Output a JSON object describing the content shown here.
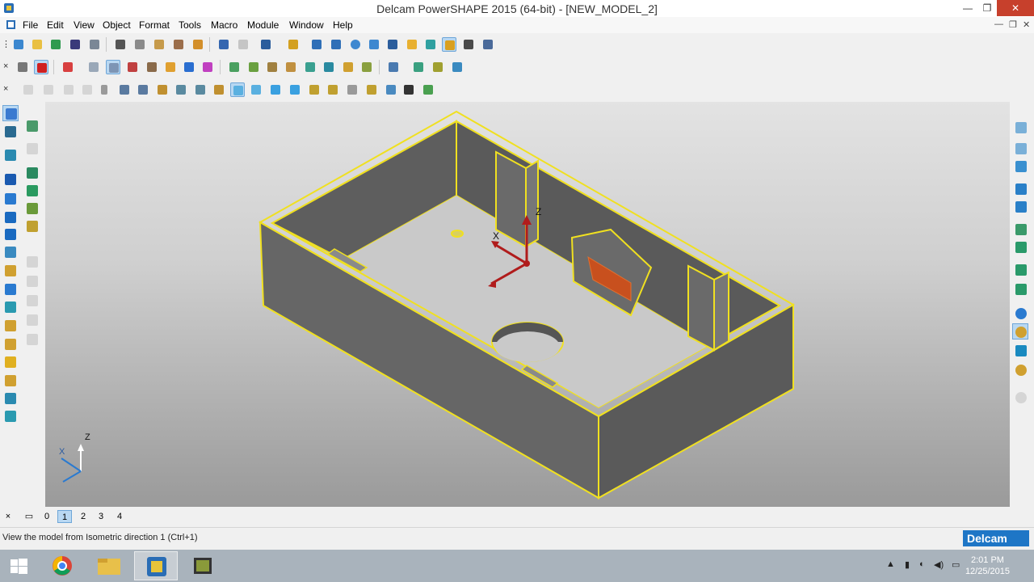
{
  "window": {
    "title": "Delcam PowerSHAPE 2015 (64-bit) - [NEW_MODEL_2]",
    "minimize": "—",
    "maximize": "❐",
    "close": "✕"
  },
  "menu": {
    "items": [
      "File",
      "Edit",
      "View",
      "Object",
      "Format",
      "Tools",
      "Macro",
      "Module",
      "Window",
      "Help"
    ],
    "mdi_minimize": "—",
    "mdi_restore": "❐",
    "mdi_close": "✕"
  },
  "toolbars": {
    "grip": "×"
  },
  "viewport": {
    "model_axis_x": "X",
    "model_axis_z": "Z",
    "corner_axis_x": "X",
    "corner_axis_z": "Z",
    "colors": {
      "edge": "#f0e020",
      "wall": "#666666",
      "floor": "#c9c9c9",
      "pocket": "#c8501e",
      "axis": "#b01c1c"
    }
  },
  "levels": {
    "close": "×",
    "items": [
      "0",
      "1",
      "2",
      "3",
      "4"
    ],
    "active": "1"
  },
  "status": {
    "message": "View the model from Isometric direction 1 (Ctrl+1)",
    "logo": "Delcam"
  },
  "taskbar": {
    "time": "2:01 PM",
    "date": "12/25/2015"
  }
}
